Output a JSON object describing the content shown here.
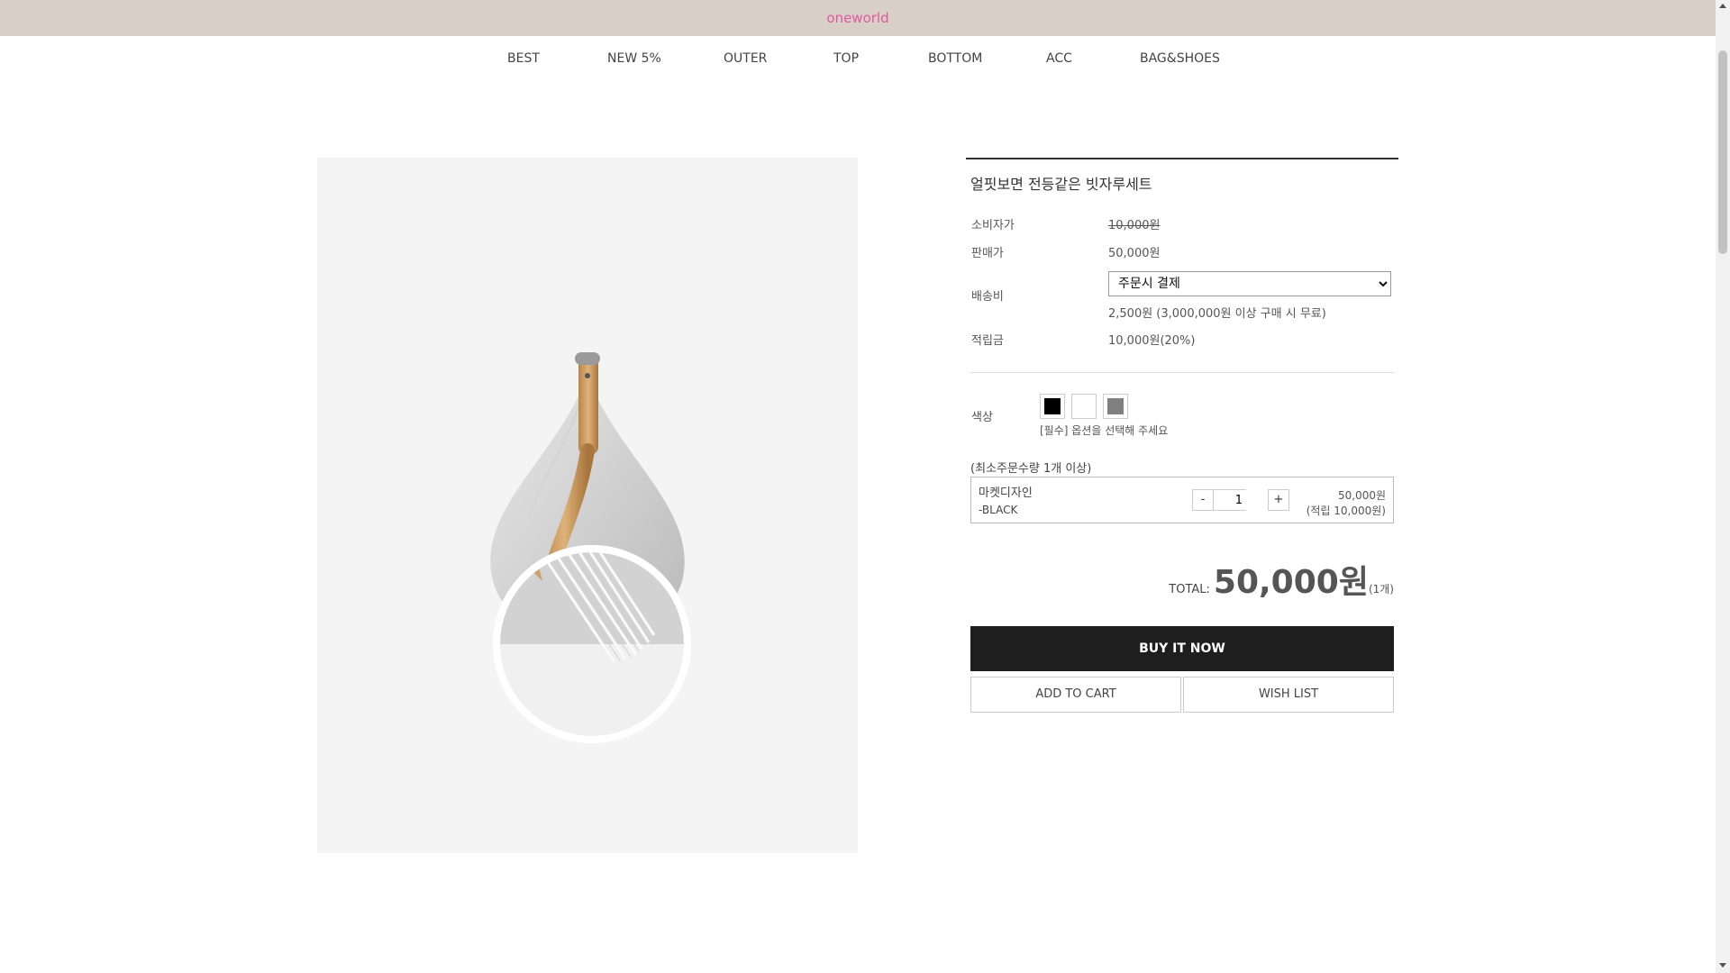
{
  "header": {
    "brand": "oneworld"
  },
  "nav": {
    "items": [
      "BEST",
      "NEW 5%",
      "OUTER",
      "TOP",
      "BOTTOM",
      "ACC",
      "BAG&SHOES"
    ]
  },
  "product": {
    "title": "얼핏보면 전등같은 빗자루세트",
    "consumer_price_label": "소비자가",
    "consumer_price": "10,000원",
    "sale_price_label": "판매가",
    "sale_price": "50,000원",
    "shipping_label": "배송비",
    "shipping_select": "주문시 결제",
    "shipping_note": "2,500원 (3,000,000원 이상 구매 시 무료)",
    "points_label": "적립금",
    "points": "10,000원(20%)",
    "color_label": "색상",
    "color_swatches": [
      {
        "name": "black",
        "color": "#000000"
      },
      {
        "name": "white",
        "color": "#ffffff"
      },
      {
        "name": "gray",
        "color": "#808080"
      }
    ],
    "color_note": "[필수] 옵션을 선택해 주세요",
    "min_qty_note": "(최소주문수량 1개 이상)",
    "option": {
      "name": "마켓디자인",
      "variant": "-BLACK",
      "minus": "-",
      "plus": "+",
      "quantity": "1",
      "price": "50,000원",
      "points": "(적립 10,000원)"
    },
    "total_label": "TOTAL:",
    "total_amount": "50,000원",
    "total_count": "(1개)",
    "buy_now": "BUY IT NOW",
    "add_to_cart": "ADD TO CART",
    "wish_list": "WISH LIST"
  }
}
